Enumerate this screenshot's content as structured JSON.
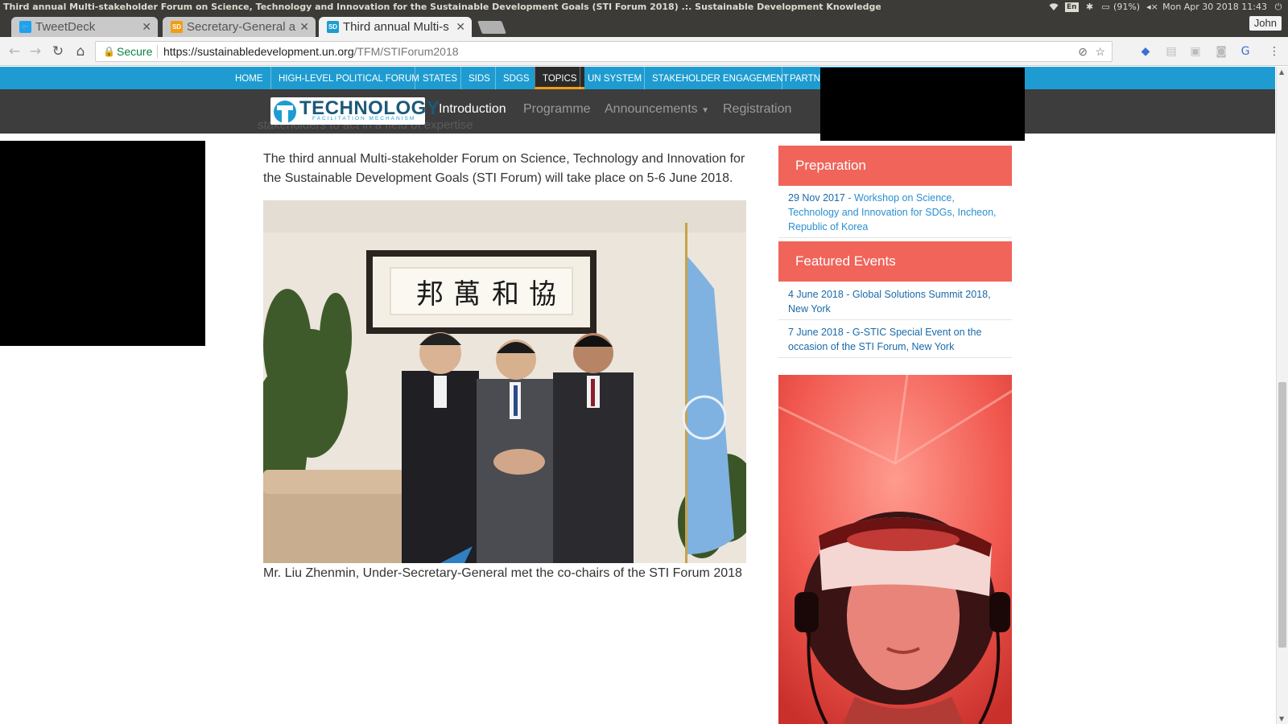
{
  "os": {
    "window_title": "Third annual Multi-stakeholder Forum on Science, Technology and Innovation for the Sustainable Development Goals (STI Forum 2018) .:. Sustainable Development Knowledge Platform - Google Chrome",
    "keyboard_layout": "En",
    "battery": "(91%)",
    "clock": "Mon Apr 30 2018 11:43",
    "icons": [
      "wifi-icon",
      "bluetooth-icon",
      "battery-icon",
      "volume-icon",
      "settings-icon"
    ]
  },
  "browser": {
    "tabs": [
      {
        "label": "TweetDeck",
        "favicon": "twitter-icon",
        "active": false
      },
      {
        "label": "Secretary-General a",
        "favicon": "sd-icon",
        "active": false
      },
      {
        "label": "Third annual Multi-s",
        "favicon": "sd-icon",
        "active": true
      }
    ],
    "profile_name": "John",
    "security_label": "Secure",
    "url_scheme_host": "https://sustainabledevelopment.un.org",
    "url_path": "/TFM/STIForum2018",
    "extension_icons": [
      "translate-blocked-icon",
      "star-icon",
      "extension-icon",
      "rss-icon",
      "puzzle-icon",
      "camera-icon",
      "google-translate-icon",
      "menu-icon"
    ]
  },
  "site_nav": {
    "items": [
      "HOME",
      "HIGH-LEVEL POLITICAL FORUM",
      "STATES",
      "SIDS",
      "SDGS",
      "TOPICS",
      "UN SYSTEM",
      "STAKEHOLDER ENGAGEMENT",
      "PARTNE"
    ],
    "active": "TOPICS"
  },
  "sub_nav": {
    "logo_text": "TECHNOLOGY",
    "logo_subtext": "FACILITATION MECHANISM",
    "links": [
      "Introduction",
      "Programme",
      "Announcements",
      "Registration"
    ],
    "active": "Introduction",
    "behind_text": "stakeholders to act in a field of expertise"
  },
  "main": {
    "intro": "The third annual Multi-stakeholder Forum on Science, Technology and Innovation for the Sustainable Development Goals (STI Forum) will take place on 5-6 June 2018.",
    "caption": "Mr. Liu Zhenmin, Under-Secretary-General met the co-chairs of the STI Forum 2018"
  },
  "sidebar": {
    "preparation": {
      "heading": "Preparation",
      "items": [
        {
          "date": "29 Nov 2017",
          "text": " - Workshop on Science, Technology and Innovation for SDGs, Incheon, Republic of Korea"
        }
      ]
    },
    "featured": {
      "heading": "Featured Events",
      "items": [
        {
          "text": "4 June 2018 - Global Solutions Summit 2018, New York"
        },
        {
          "text": "7 June 2018 - G-STIC Special Event on the occasion of the STI Forum, New York"
        }
      ]
    }
  }
}
